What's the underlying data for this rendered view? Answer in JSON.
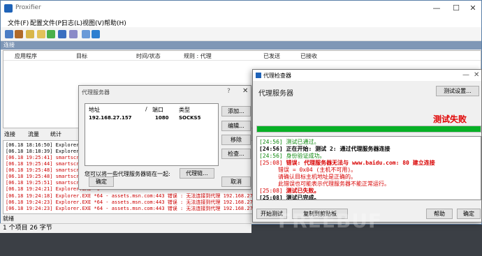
{
  "main_window": {
    "title": "Proxifier",
    "menu": [
      "文件(F)",
      "配置文件(P)",
      "日志(L)",
      "视图(V)",
      "帮助(H)"
    ],
    "connections_bar": "连接",
    "columns": [
      "应用程序",
      "目标",
      "时间/状态",
      "规则 : 代理",
      "已发送",
      "已接收"
    ],
    "tabs": [
      "连接",
      "流量",
      "统计"
    ],
    "log": [
      {
        "text": "[06.18 18:16:50] Explorer.EXE *6",
        "color": "#000000"
      },
      {
        "text": "[06.18 18:18:39] Explorer.EXE *6",
        "color": "#000000"
      },
      {
        "text": "[06.18 19:25:41] smartscreen.exe",
        "color": "#cc0000"
      },
      {
        "text": "[06.18 19:25:44] smartscreen.exe",
        "color": "#cc0000"
      },
      {
        "text": "[06.18 19:25:48] smartscreen.exe",
        "color": "#cc0000"
      },
      {
        "text": "[06.18 19:25:48] smartscreen.exe",
        "color": "#cc0000"
      },
      {
        "text": "[06.18 19:25:51] smartscreen.exe",
        "color": "#cc0000"
      },
      {
        "text": "[06.18 19:24:21] Explorer.EXE *6",
        "color": "#cc0000"
      },
      {
        "text": "[06.18 19:24:18] Explorer.EXE *64 - assets.msn.com:443 错误 : 无法连接到代理 192.168.27.157:8077 - 连接",
        "color": "#cc0000"
      },
      {
        "text": "[06.18 19:24:23] Explorer.EXE *64 - assets.msn.com:443 错误 : 无法连接到代理 192.168.27.157:8077 - 连接",
        "color": "#cc0000"
      },
      {
        "text": "[06.18 19:24:23] Explorer.EXE *64 - assets.msn.com:443 错误 : 无法连接到代理 192.168.27.157:8077 - 连接",
        "color": "#cc0000"
      }
    ],
    "status_ready": "就绪",
    "status_bottom": "1 个项目  26 字节"
  },
  "servers_dialog": {
    "title": "代理服务器",
    "help": "?",
    "headers": [
      "地址",
      "/",
      "端口",
      "类型"
    ],
    "row": {
      "address": "192.168.27.157",
      "port": "1080",
      "type": "SOCKS5"
    },
    "buttons": [
      "添加...",
      "编辑...",
      "移除",
      "检查..."
    ],
    "note": "您可以将一些代理服务器链在一起:",
    "chain_button": "代理链...",
    "ok": "确定",
    "cancel": "取消"
  },
  "checker_dialog": {
    "title": "代理检查器",
    "subtitle": "代理服务器",
    "settings_button": "测试设置...",
    "fail_text": "测试失败",
    "progress": 1.0,
    "log": [
      {
        "time": "[24:56]",
        "text": "测试已通过。",
        "style": "green"
      },
      {
        "time": "[24:56]",
        "text": "正在开始: 测试 2: 通过代理服务器连接",
        "style": "blk"
      },
      {
        "time": "[24:56]",
        "text": "身份验证成功。",
        "style": "green"
      },
      {
        "time": "[25:08]",
        "text": "错误: 代理服务器无法与 www.baidu.com: 80 建立连接",
        "style": "red"
      },
      {
        "time": "",
        "text": "错误 = 0x04 (主机不可用)。",
        "style": "red"
      },
      {
        "time": "",
        "text": "请确认目标主机地址是正确的。",
        "style": "red"
      },
      {
        "time": "",
        "text": "此错误也可能表示代理服务器不能正常运行。",
        "style": "red"
      },
      {
        "time": "[25:08]",
        "text": "测试已失败。",
        "style": "red"
      },
      {
        "time": "[25:08]",
        "text": "测试已完成。",
        "style": "blk"
      }
    ],
    "start_button": "开始测试",
    "copy_button": "复制到剪贴板",
    "help_button": "帮助",
    "ok_button": "确定"
  },
  "watermark": "FREEBUF"
}
